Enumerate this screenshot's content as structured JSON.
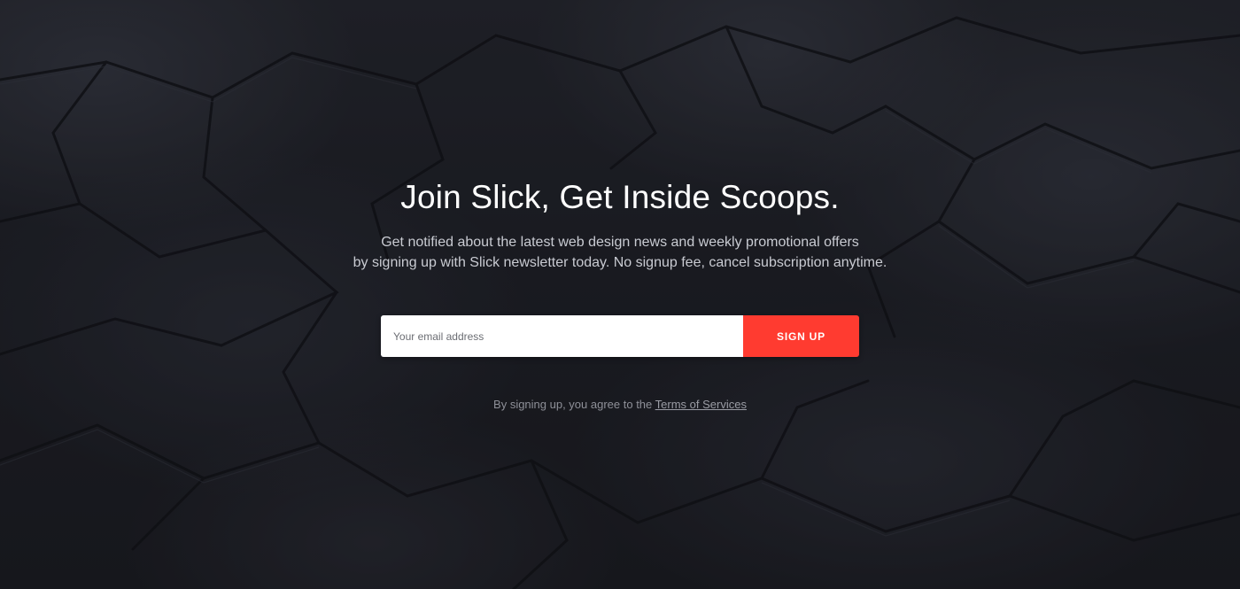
{
  "hero": {
    "title": "Join Slick, Get Inside Scoops.",
    "subtitle_line1": "Get notified about the latest web design news and weekly promotional offers",
    "subtitle_line2": "by signing up with Slick newsletter today. No signup fee, cancel subscription anytime."
  },
  "form": {
    "email_placeholder": "Your email address",
    "email_value": "",
    "submit_label": "SIGN UP"
  },
  "terms": {
    "prefix": "By signing up, you agree to the",
    "link_label": "Terms of Services"
  },
  "colors": {
    "accent": "#ff3b30",
    "background": "#1b1c21",
    "title": "#ffffff",
    "subtitle": "#c9cbd2"
  }
}
